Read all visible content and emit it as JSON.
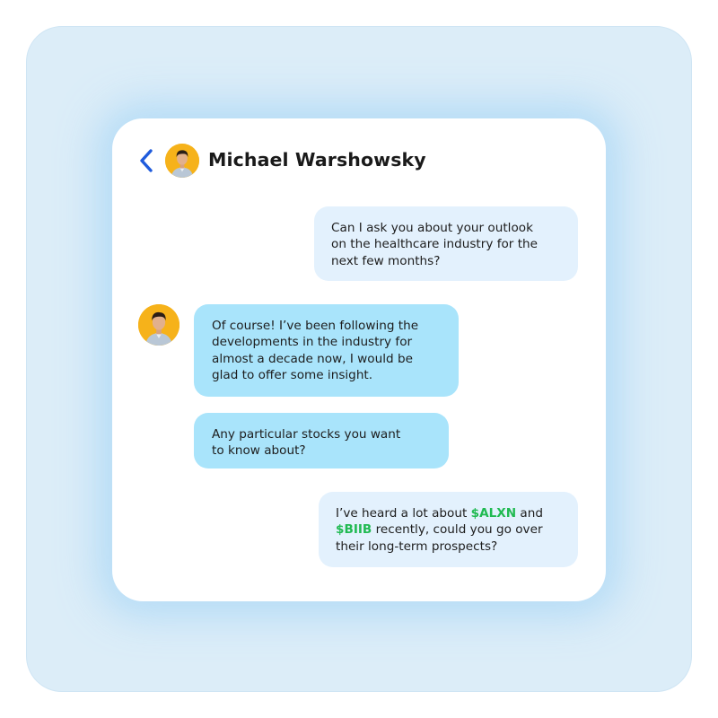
{
  "header": {
    "back_icon": "chevron-left-icon",
    "avatar_icon": "contact-avatar",
    "contact_name": "Michael Warshowsky"
  },
  "colors": {
    "backdrop": "#dcedf8",
    "outgoing_bubble": "#e3f1fd",
    "incoming_bubble": "#a9e4fb",
    "back_arrow": "#1f5bdc",
    "ticker": "#21ba52",
    "avatar_background": "#f6b21a"
  },
  "messages": [
    {
      "direction": "outgoing",
      "lines": [
        "Can I ask you about your outlook",
        "on the healthcare industry for the",
        "next few months?"
      ]
    },
    {
      "direction": "incoming",
      "lines": [
        "Of course! I’ve been following the",
        "developments in the industry for",
        "almost a decade now, I would be",
        "glad to offer some insight."
      ]
    },
    {
      "direction": "incoming",
      "lines": [
        "Any particular stocks you want",
        "to know about?"
      ]
    },
    {
      "direction": "outgoing",
      "line1_pre": "I’ve heard a lot about ",
      "ticker1": "$ALXN",
      "line1_post": " and",
      "ticker2": "$BIIB",
      "line2_post": " recently, could you go over",
      "line3": "their long-term prospects?"
    }
  ]
}
